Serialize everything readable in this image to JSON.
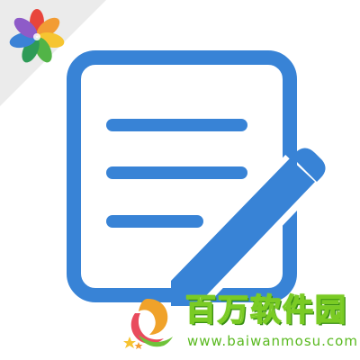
{
  "icon": {
    "name": "notes-edit-icon",
    "primary_color": "#3883d6",
    "line_color": "#3883d6",
    "background_color": "#ffffff"
  },
  "corner_badge": {
    "name": "pinwheel-logo",
    "ribbon_color": "#e9e9e9",
    "petal_colors": [
      "#e8453c",
      "#f29c34",
      "#f6c531",
      "#52b447",
      "#2e9b57",
      "#3b82d6",
      "#8e5bc8"
    ]
  },
  "watermark": {
    "brand_text": "百万软件园",
    "url_text": "www.baiwanmosu.com",
    "brand_color": "#7acb24",
    "url_color": "#59b91f"
  }
}
